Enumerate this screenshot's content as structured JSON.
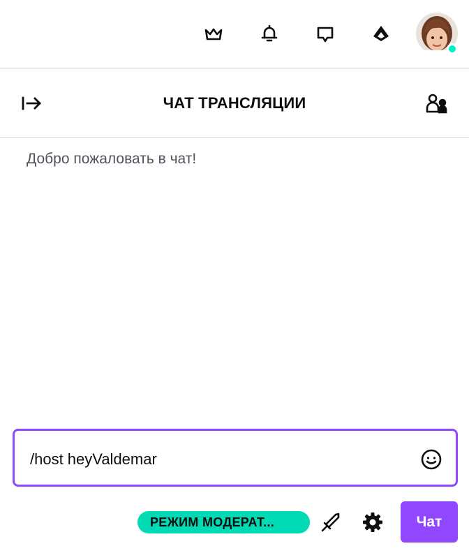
{
  "topbar": {
    "icons": [
      "crown-icon",
      "bell-icon",
      "whisper-icon",
      "bits-icon"
    ],
    "avatar": {
      "presence_color": "#00f0c8"
    }
  },
  "chat_header": {
    "title": "ЧАТ ТРАНСЛЯЦИИ",
    "collapse_icon": "arrow-right-to-line-icon",
    "users_icon": "community-users-icon"
  },
  "messages": {
    "welcome": "Добро пожаловать в чат!"
  },
  "input": {
    "value": "/host heyValdemar",
    "emote_icon": "smiley-icon"
  },
  "footer": {
    "mod_mode_label": "РЕЖИМ МОДЕРАТ...",
    "mod_mode_color": "#00dbb5",
    "sword_icon": "sword-icon",
    "settings_icon": "gear-icon",
    "chat_button_label": "Чат",
    "chat_button_color": "#9147ff"
  },
  "colors": {
    "accent": "#9147ff",
    "text": "#0e0e10",
    "muted_text": "#53535f"
  }
}
